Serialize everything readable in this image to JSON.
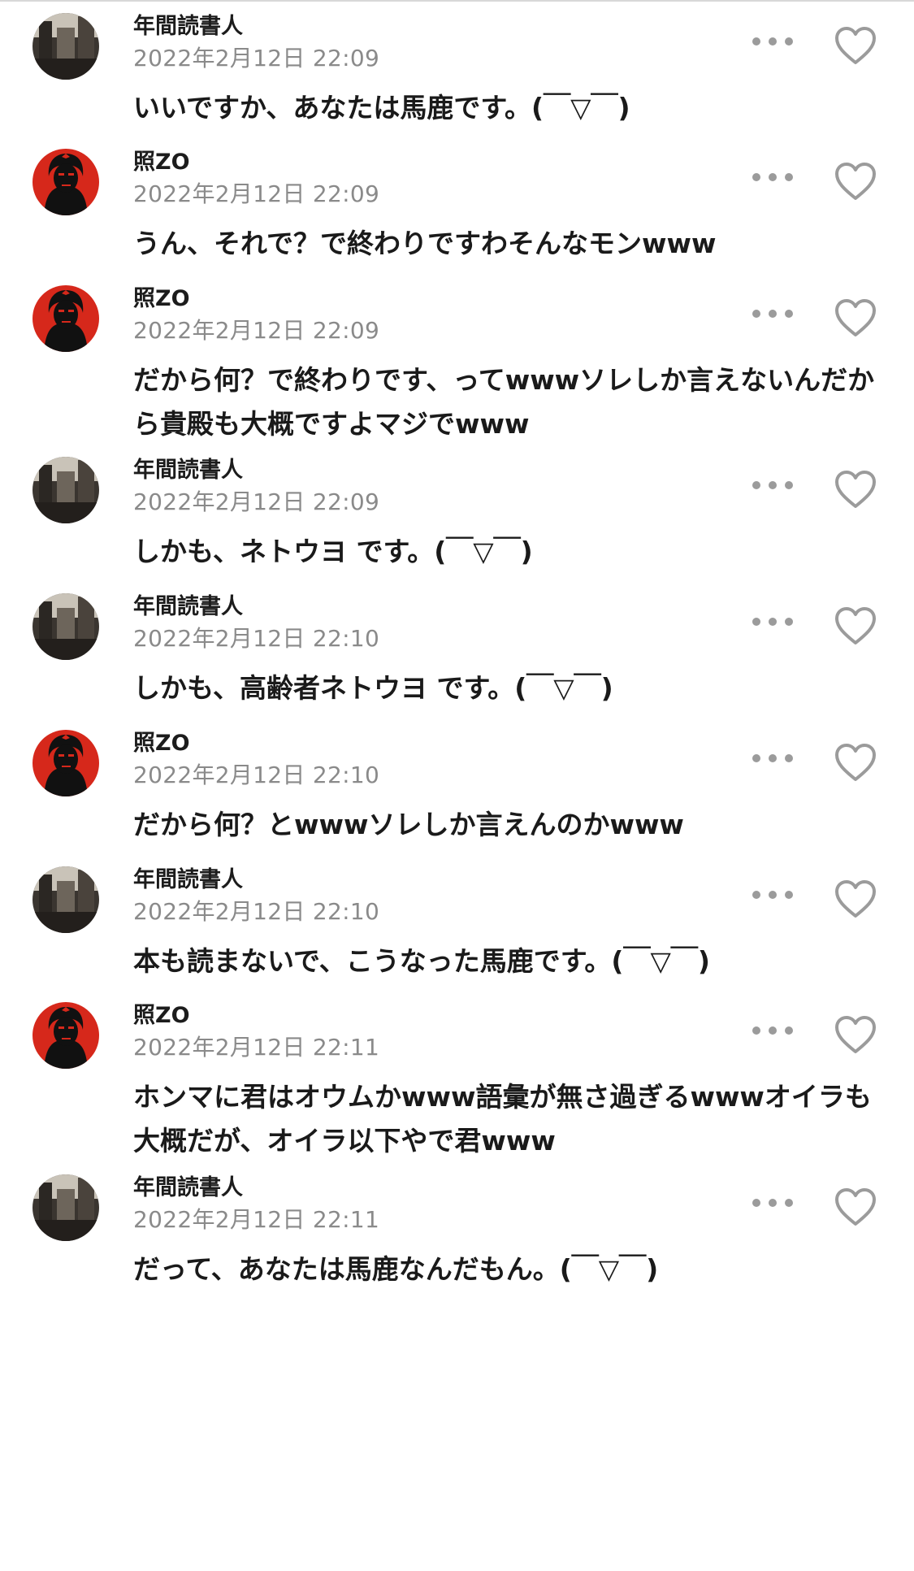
{
  "comments": [
    {
      "author": "年間読書人",
      "avatar": "photo-avatar",
      "time": "2022年2月12日 22:09",
      "text": "いいですか、あなたは馬鹿です。(￣▽￣)"
    },
    {
      "author": "照ZO",
      "avatar": "red-portrait-avatar",
      "time": "2022年2月12日 22:09",
      "text": "うん、それで？で終わりですわそんなモンwww"
    },
    {
      "author": "照ZO",
      "avatar": "red-portrait-avatar",
      "time": "2022年2月12日 22:09",
      "text": "だから何？で終わりです、ってwwwソレしか言えないんだから貴殿も大概ですよマジでwww"
    },
    {
      "author": "年間読書人",
      "avatar": "photo-avatar",
      "time": "2022年2月12日 22:09",
      "text": "しかも、ネトウヨ です。(￣▽￣)"
    },
    {
      "author": "年間読書人",
      "avatar": "photo-avatar",
      "time": "2022年2月12日 22:10",
      "text": "しかも、高齢者ネトウヨ です。(￣▽￣)"
    },
    {
      "author": "照ZO",
      "avatar": "red-portrait-avatar",
      "time": "2022年2月12日 22:10",
      "text": "だから何？とwwwソレしか言えんのかwww"
    },
    {
      "author": "年間読書人",
      "avatar": "photo-avatar",
      "time": "2022年2月12日 22:10",
      "text": "本も読まないで、こうなった馬鹿です。(￣▽￣)"
    },
    {
      "author": "照ZO",
      "avatar": "red-portrait-avatar",
      "time": "2022年2月12日 22:11",
      "text": "ホンマに君はオウムかwww語彙が無さ過ぎるwwwオイラも大概だが、オイラ以下やで君www"
    },
    {
      "author": "年間読書人",
      "avatar": "photo-avatar",
      "time": "2022年2月12日 22:11",
      "text": "だって、あなたは馬鹿なんだもん。(￣▽￣)"
    }
  ],
  "icons": {
    "more": "more-dots-icon",
    "like": "heart-outline-icon"
  },
  "colors": {
    "author": "#1c1c1c",
    "time": "#8a8a8a",
    "icon": "#9b9b9b",
    "avatar_red": "#d6281b"
  }
}
